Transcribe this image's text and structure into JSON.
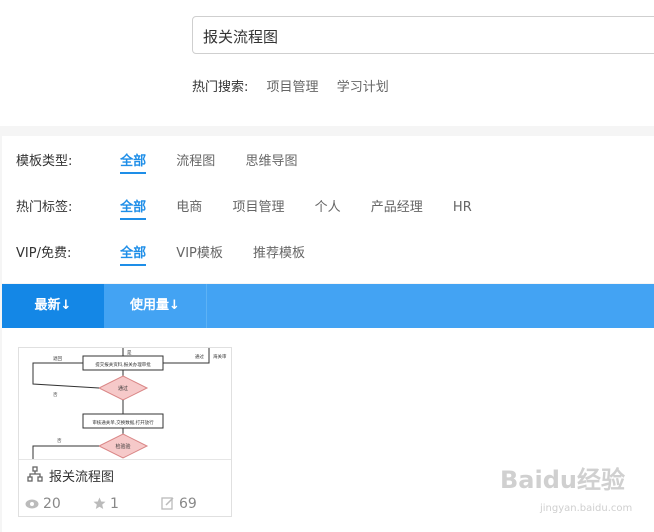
{
  "search": {
    "value": "报关流程图"
  },
  "hot_search": {
    "label": "热门搜索:",
    "items": [
      "项目管理",
      "学习计划"
    ]
  },
  "filters": {
    "template_type": {
      "label": "模板类型:",
      "options": [
        "全部",
        "流程图",
        "思维导图"
      ]
    },
    "hot_tags": {
      "label": "热门标签:",
      "options": [
        "全部",
        "电商",
        "项目管理",
        "个人",
        "产品经理",
        "HR"
      ]
    },
    "vip": {
      "label": "VIP/免费:",
      "options": [
        "全部",
        "VIP模板",
        "推荐模板"
      ]
    }
  },
  "sort": {
    "newest": "最新↓",
    "usage": "使用量↓"
  },
  "card": {
    "title": "报关流程图",
    "views": "20",
    "likes": "1",
    "edits": "69",
    "thumb_labels": {
      "box1": "提交报关资料,报关办理审批",
      "diamond1": "通过",
      "box2": "审核通关单,交换数据,打开放行",
      "diamond2": "检验验",
      "left1": "退回",
      "right1": "通过",
      "right2": "海关审",
      "no1": "否",
      "no2": "否",
      "start": "是"
    }
  },
  "watermark": {
    "main": "Baidu经验",
    "sub": "jingyan.baidu.com"
  },
  "colors": {
    "accent": "#1e8ee8",
    "sort_bar": "#43a3f3",
    "sort_active": "#1487e6"
  }
}
